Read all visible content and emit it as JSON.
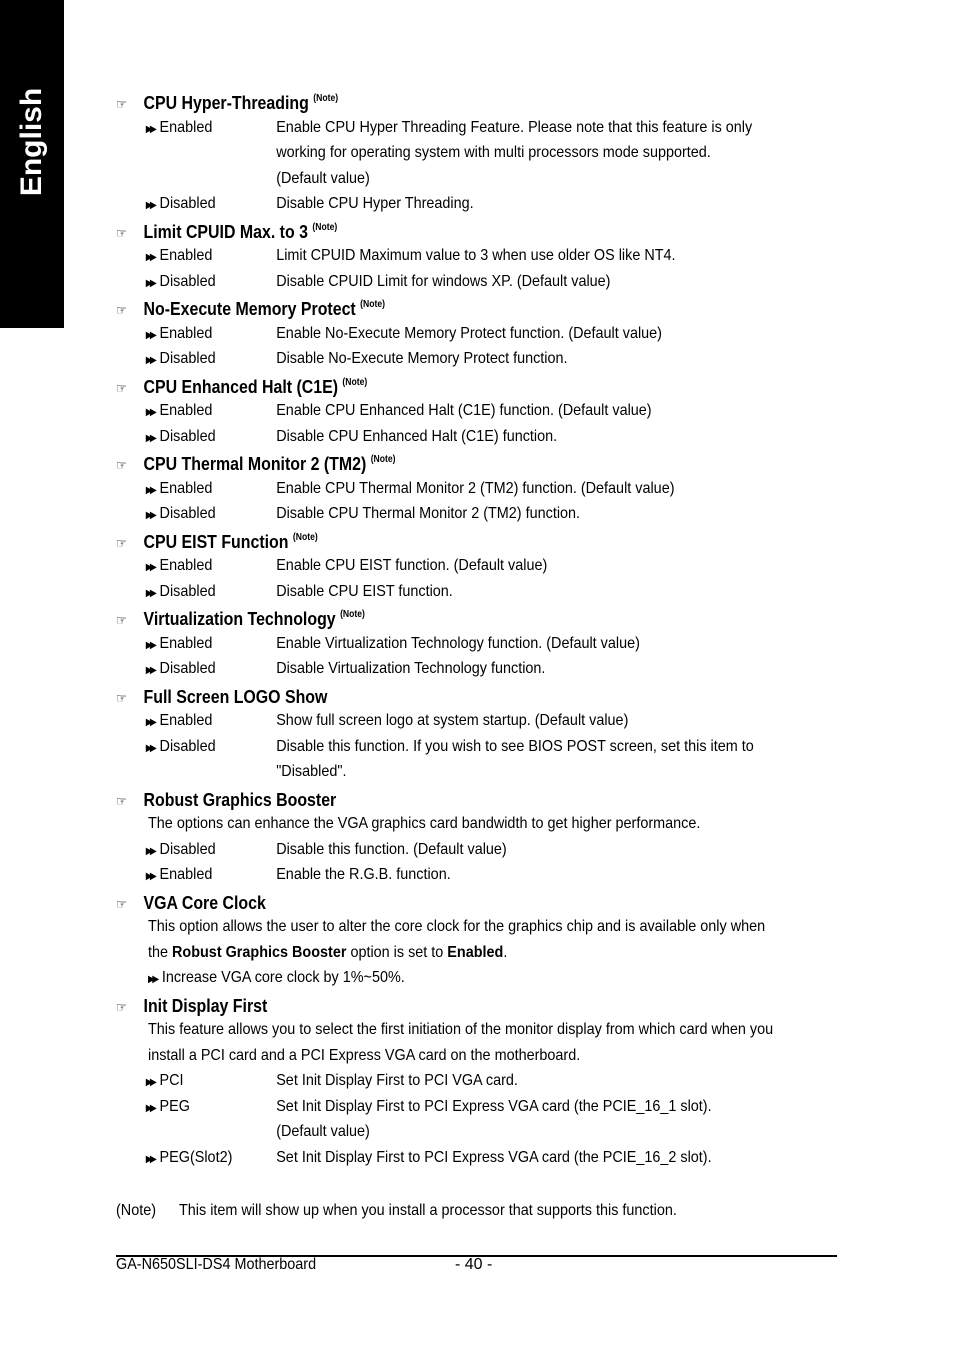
{
  "side_tab": "English",
  "sections": [
    {
      "title": "CPU Hyper-Threading",
      "note": "(Note)",
      "options": [
        {
          "name": "Enabled",
          "desc": [
            "Enable CPU Hyper Threading Feature. Please note that this feature is only",
            "working for operating system with multi processors mode supported.",
            "(Default value)"
          ]
        },
        {
          "name": "Disabled",
          "desc": [
            "Disable CPU Hyper Threading."
          ]
        }
      ]
    },
    {
      "title": "Limit CPUID Max. to 3",
      "note": "(Note)",
      "options": [
        {
          "name": "Enabled",
          "desc": [
            "Limit CPUID Maximum value to 3 when use older OS like NT4."
          ]
        },
        {
          "name": "Disabled",
          "desc": [
            "Disable CPUID Limit for windows XP. (Default value)"
          ]
        }
      ]
    },
    {
      "title": "No-Execute Memory Protect",
      "note": "(Note)",
      "options": [
        {
          "name": "Enabled",
          "desc": [
            "Enable No-Execute Memory Protect function. (Default value)"
          ]
        },
        {
          "name": "Disabled",
          "desc": [
            "Disable No-Execute Memory Protect function."
          ]
        }
      ]
    },
    {
      "title": "CPU Enhanced Halt (C1E)",
      "note": "(Note)",
      "options": [
        {
          "name": "Enabled",
          "desc": [
            "Enable CPU Enhanced Halt (C1E) function. (Default value)"
          ]
        },
        {
          "name": "Disabled",
          "desc": [
            "Disable CPU Enhanced Halt (C1E) function."
          ]
        }
      ]
    },
    {
      "title": "CPU Thermal Monitor 2 (TM2)",
      "note": "(Note)",
      "options": [
        {
          "name": "Enabled",
          "desc": [
            "Enable CPU Thermal Monitor 2 (TM2) function. (Default value)"
          ]
        },
        {
          "name": "Disabled",
          "desc": [
            "Disable CPU Thermal Monitor 2 (TM2) function."
          ]
        }
      ]
    },
    {
      "title": "CPU EIST Function",
      "note": "(Note)",
      "options": [
        {
          "name": "Enabled",
          "desc": [
            "Enable CPU EIST function. (Default value)"
          ]
        },
        {
          "name": "Disabled",
          "desc": [
            "Disable CPU EIST function."
          ]
        }
      ]
    },
    {
      "title": "Virtualization Technology",
      "note": "(Note)",
      "options": [
        {
          "name": "Enabled",
          "desc": [
            "Enable Virtualization Technology function. (Default value)"
          ]
        },
        {
          "name": "Disabled",
          "desc": [
            "Disable Virtualization Technology function."
          ]
        }
      ]
    },
    {
      "title": "Full Screen LOGO Show",
      "note": "",
      "options": [
        {
          "name": "Enabled",
          "desc": [
            "Show full screen logo at system startup. (Default value)"
          ]
        },
        {
          "name": "Disabled",
          "desc": [
            "Disable this function. If you wish to see BIOS POST screen, set this item to",
            "\"Disabled\"."
          ]
        }
      ]
    },
    {
      "title": "Robust Graphics Booster",
      "note": "",
      "intro": [
        "The options can enhance the VGA graphics card bandwidth to get higher performance."
      ],
      "options": [
        {
          "name": "Disabled",
          "desc": [
            "Disable this function. (Default value)"
          ]
        },
        {
          "name": "Enabled",
          "desc": [
            "Enable the R.G.B. function."
          ]
        }
      ]
    },
    {
      "title": "VGA Core Clock",
      "note": "",
      "intro": [
        "This option allows the user to alter the core clock for the graphics chip and is available only when"
      ],
      "intro2": {
        "pre": "the ",
        "b1": "Robust Graphics Booster",
        "mid": " option is set to ",
        "b2": "Enabled",
        "post": "."
      },
      "bullet": "Increase VGA core clock by 1%~50%.",
      "options": []
    },
    {
      "title": "Init Display First",
      "note": "",
      "intro": [
        "This feature allows you to select the first initiation of the monitor display from which card when you",
        "install a PCI card and a PCI Express VGA card on the motherboard."
      ],
      "options": [
        {
          "name": "PCI",
          "desc": [
            "Set Init Display First to PCI VGA card."
          ]
        },
        {
          "name": "PEG",
          "desc": [
            "Set Init Display First to PCI Express VGA card (the PCIE_16_1 slot).",
            "(Default value)"
          ]
        },
        {
          "name": "PEG(Slot2)",
          "desc": [
            "Set Init Display First to PCI Express VGA card (the PCIE_16_2 slot)."
          ]
        }
      ]
    }
  ],
  "footnote": {
    "label": "(Note)",
    "text": "This item will show up when you install a processor that supports this function."
  },
  "footer": {
    "model": "GA-N650SLI-DS4 Motherboard",
    "page": "- 40 -"
  }
}
